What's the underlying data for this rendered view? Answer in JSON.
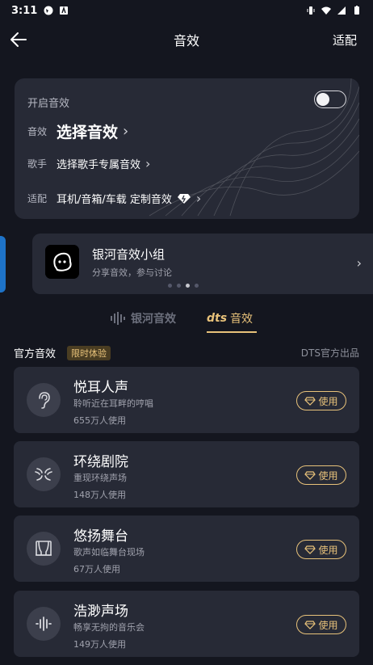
{
  "status": {
    "time": "3:11"
  },
  "header": {
    "title": "音效",
    "adapt_label": "适配"
  },
  "effect_card": {
    "enable_label": "开启音效",
    "enabled": false,
    "effect_label": "音效",
    "effect_value": "选择音效",
    "singer_label": "歌手",
    "singer_value": "选择歌手专属音效",
    "adapt_label": "适配",
    "adapt_value": "耳机/音箱/车载 定制音效"
  },
  "group": {
    "title": "银河音效小组",
    "subtitle": "分享音效，参与讨论",
    "pager_total": 4,
    "pager_active_index": 2
  },
  "tabs": [
    {
      "brand": "银河音效",
      "label": "",
      "active": false
    },
    {
      "brand": "dts",
      "label": "音效",
      "active": true
    }
  ],
  "section": {
    "title": "官方音效",
    "badge": "限时体验",
    "source": "DTS官方出品"
  },
  "items": [
    {
      "name": "悦耳人声",
      "desc": "聆听近在耳畔的哼唱",
      "users": "655万人使用",
      "button": "使用",
      "icon": "ear-icon"
    },
    {
      "name": "环绕剧院",
      "desc": "重现环绕声场",
      "users": "148万人使用",
      "button": "使用",
      "icon": "surround-icon"
    },
    {
      "name": "悠扬舞台",
      "desc": "歌声如临舞台现场",
      "users": "67万人使用",
      "button": "使用",
      "icon": "stage-icon"
    },
    {
      "name": "浩渺声场",
      "desc": "畅享无拘的音乐会",
      "users": "149万人使用",
      "button": "使用",
      "icon": "soundwave-icon"
    }
  ],
  "colors": {
    "accent_gold": "#e8c27a",
    "background": "#14161f",
    "card": "#272a36",
    "side_tab": "#1e73c8"
  }
}
